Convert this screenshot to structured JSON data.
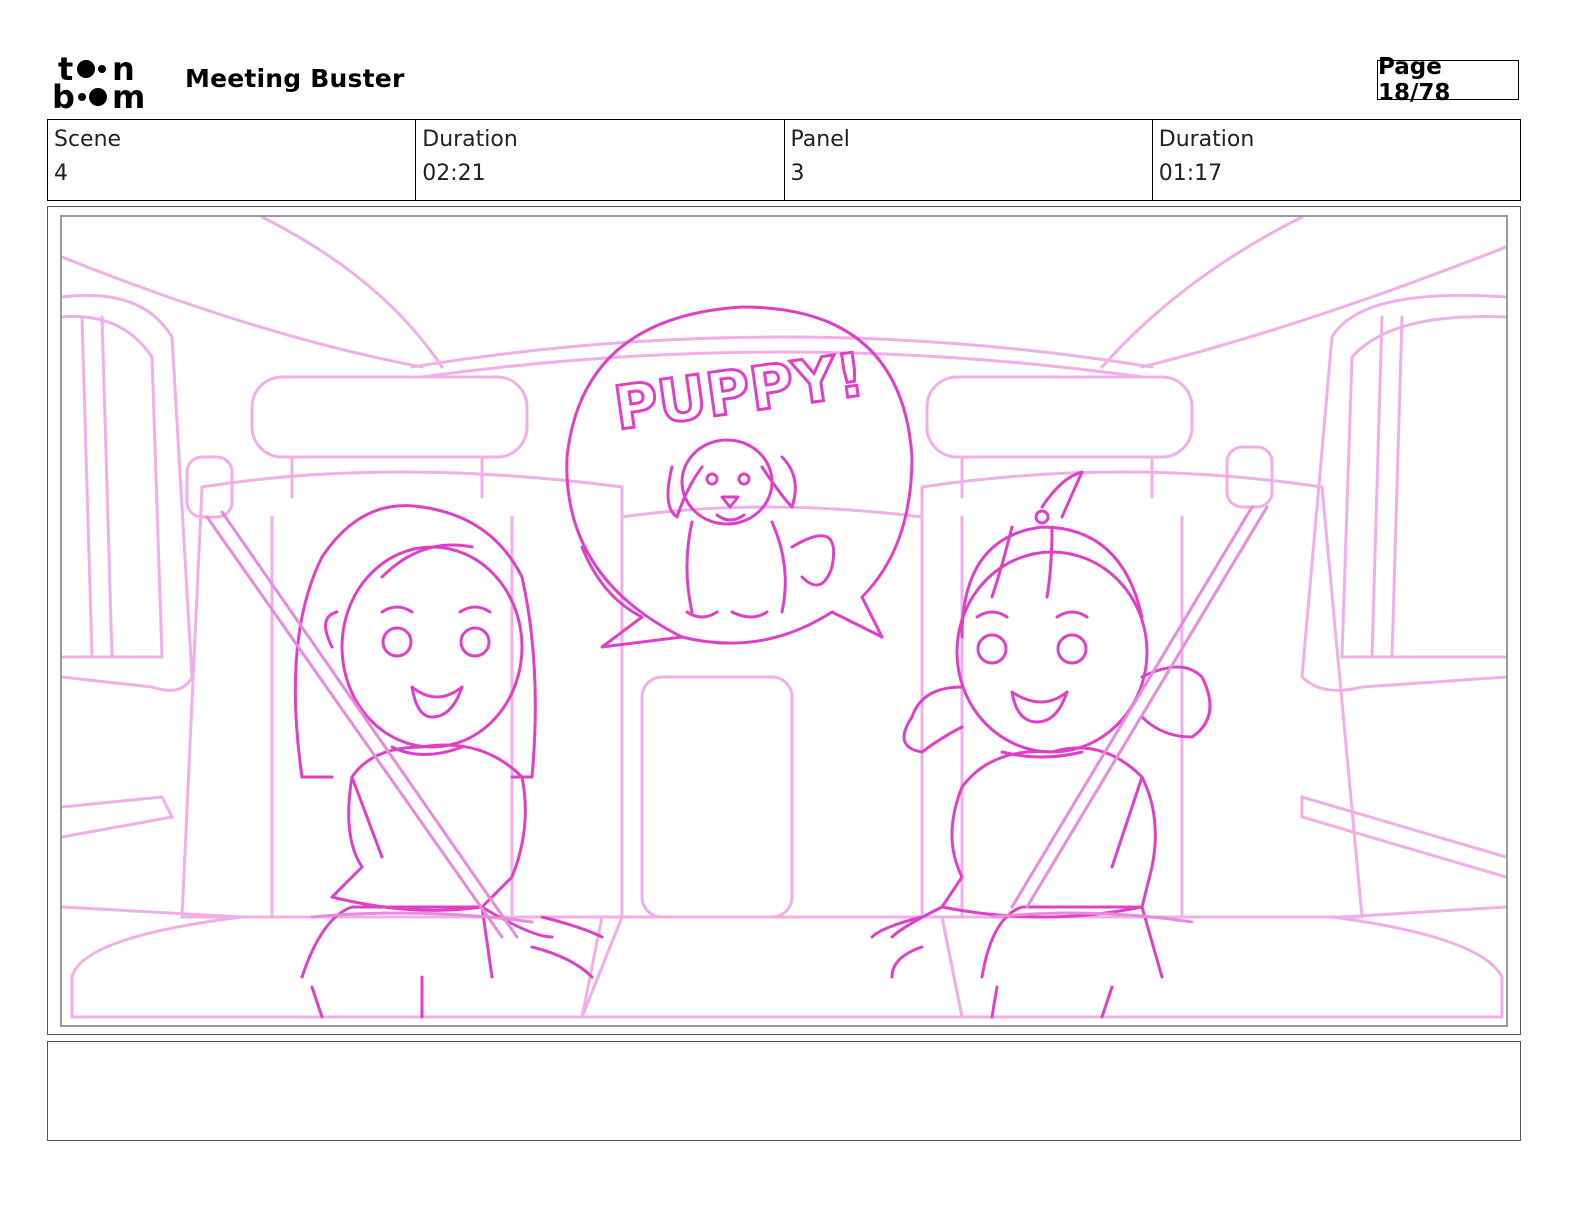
{
  "header": {
    "logo_text": "toon boom",
    "project_title": "Meeting Buster",
    "page_label": "Page 18/78"
  },
  "info": {
    "scene_label": "Scene",
    "scene_value": "4",
    "scene_duration_label": "Duration",
    "scene_duration_value": "02:21",
    "panel_label": "Panel",
    "panel_value": "3",
    "panel_duration_label": "Duration",
    "panel_duration_value": "01:17"
  },
  "panel": {
    "speech_text": "PUPPY!",
    "sketch_color": "#e040c8",
    "background_sketch_color": "#f0a8e6"
  },
  "notes": {
    "text": ""
  }
}
